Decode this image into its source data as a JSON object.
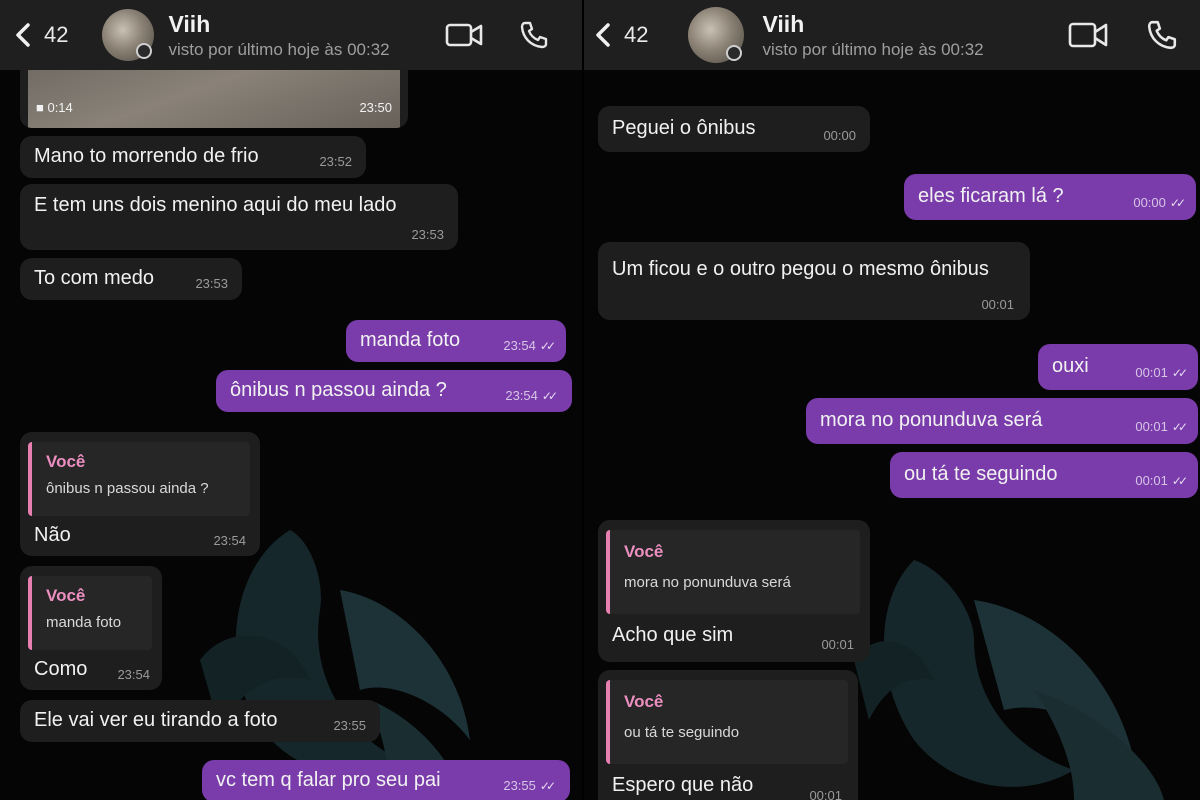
{
  "left": {
    "header": {
      "unread_count": "42",
      "contact_name": "Viih",
      "last_seen": "visto por último hoje às 00:32"
    },
    "video": {
      "duration": "0:14",
      "time": "23:50"
    },
    "messages": [
      {
        "text": "Mano to morrendo de frio",
        "time": "23:52"
      },
      {
        "text": "E tem uns dois menino aqui do meu lado",
        "time": "23:53"
      },
      {
        "text": "To com medo",
        "time": "23:53"
      },
      {
        "text": "manda foto",
        "time": "23:54"
      },
      {
        "text": "ônibus n passou ainda ?",
        "time": "23:54"
      },
      {
        "quote_author": "Você",
        "quote_text": "ônibus n passou ainda ?",
        "text": "Não",
        "time": "23:54"
      },
      {
        "quote_author": "Você",
        "quote_text": "manda foto",
        "text": "Como",
        "time": "23:54"
      },
      {
        "text": "Ele vai ver eu tirando a foto",
        "time": "23:55"
      },
      {
        "text": "vc tem q falar pro seu pai",
        "time": "23:55"
      }
    ]
  },
  "right": {
    "header": {
      "unread_count": "42",
      "contact_name": "Viih",
      "last_seen": "visto por último hoje às 00:32"
    },
    "messages": [
      {
        "text": "Peguei o ônibus",
        "time": "00:00"
      },
      {
        "text": "eles ficaram lá ?",
        "time": "00:00"
      },
      {
        "text": "Um ficou e o outro pegou o mesmo ônibus",
        "time": "00:01"
      },
      {
        "text": "ouxi",
        "time": "00:01"
      },
      {
        "text": "mora no ponunduva será",
        "time": "00:01"
      },
      {
        "text": "ou tá te seguindo",
        "time": "00:01"
      },
      {
        "quote_author": "Você",
        "quote_text": "mora no ponunduva será",
        "text": "Acho que sim",
        "time": "00:01"
      },
      {
        "quote_author": "Você",
        "quote_text": "ou tá te seguindo",
        "text": "Espero que não",
        "time": "00:01"
      }
    ]
  },
  "colors": {
    "background": "#050505",
    "header": "#1f1f1f",
    "incoming_bubble": "#1e1e1e",
    "outgoing_bubble": "#7a3cab",
    "quote_accent": "#e77fb0"
  },
  "icons": {
    "back": "chevron-left-icon",
    "video_call": "video-camera-icon",
    "voice_call": "phone-icon",
    "read_receipt": "double-check-icon"
  }
}
